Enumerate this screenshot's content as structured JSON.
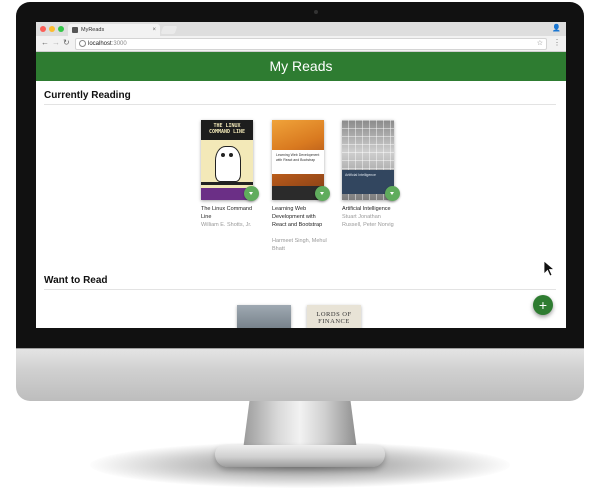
{
  "browser": {
    "tab_title": "MyReads",
    "tab_close": "×",
    "url_host": "localhost",
    "url_port": ":3000",
    "back_glyph": "←",
    "forward_glyph": "→",
    "reload_glyph": "↻",
    "star_glyph": "☆",
    "menu_glyph": "⋮",
    "profile_glyph": "👤"
  },
  "app": {
    "title": "My Reads",
    "accent_color": "#2e7c31",
    "changer_color": "#60ac5d",
    "add_button_label": "+"
  },
  "shelves": [
    {
      "title": "Currently Reading",
      "books": [
        {
          "title": "The Linux Command Line",
          "authors": "William E. Shotts, Jr.",
          "cover_text": "THE LINUX COMMAND LINE"
        },
        {
          "title": "Learning Web Development with React and Bootstrap",
          "authors": "Harmeet Singh, Mehul Bhatt",
          "cover_text": "Learning Web Development with React and Bootstrap"
        },
        {
          "title": "Artificial Intelligence",
          "authors": "Stuart Jonathan Russell, Peter Norvig",
          "cover_text": "Artificial Intelligence"
        }
      ]
    },
    {
      "title": "Want to Read",
      "books": [
        {
          "cover_text": ""
        },
        {
          "cover_text": "LORDS OF FINANCE"
        }
      ]
    }
  ]
}
